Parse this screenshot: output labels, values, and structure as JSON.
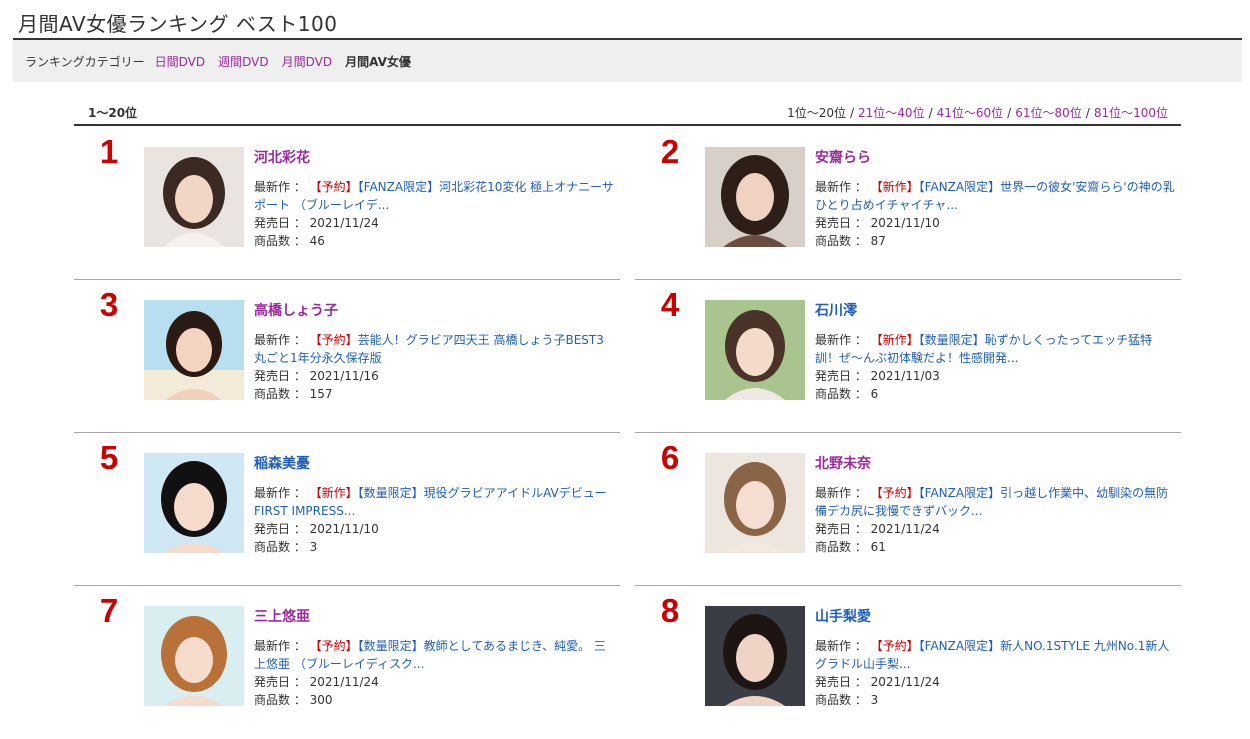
{
  "page_title": "月間AV女優ランキング ベスト100",
  "category_bar": {
    "label": "ランキングカテゴリー",
    "links": [
      "日間DVD",
      "週間DVD",
      "月間DVD"
    ],
    "current": "月間AV女優"
  },
  "range_label": "1～20位",
  "pager": {
    "current": "1位～20位",
    "links": [
      "21位～40位",
      "41位～60位",
      "61位～80位",
      "81位～100位"
    ],
    "separator": "/"
  },
  "labels": {
    "latest": "最新作 ：",
    "release_date": "発売日 ：",
    "item_count": "商品数 ："
  },
  "colors": {
    "rank": "#cc0000",
    "link_purple": "#9b2a9e",
    "link_blue": "#1f5fb8"
  },
  "ranking": [
    {
      "rank": "1",
      "name": "河北彩花",
      "name_color": "purple",
      "tag": "【予約】",
      "work": "【FANZA限定】河北彩花10変化 極上オナニーサポート （ブルーレイデ...",
      "release_date": "2021/11/24",
      "item_count": "46"
    },
    {
      "rank": "2",
      "name": "安齋らら",
      "name_color": "purple",
      "tag": "【新作】",
      "work": "【FANZA限定】世界一の彼女'安齋らら'の神の乳ひとり占めイチャイチャ...",
      "release_date": "2021/11/10",
      "item_count": "87"
    },
    {
      "rank": "3",
      "name": "高橋しょう子",
      "name_color": "purple",
      "tag": "【予約】",
      "work": "芸能人！グラビア四天王 高橋しょう子BEST3丸ごと1年分永久保存版",
      "release_date": "2021/11/16",
      "item_count": "157"
    },
    {
      "rank": "4",
      "name": "石川澪",
      "name_color": "blue",
      "tag": "【新作】",
      "work": "【数量限定】恥ずかしくったってエッチ猛特訓！ぜ～んぶ初体験だよ！性感開発...",
      "release_date": "2021/11/03",
      "item_count": "6"
    },
    {
      "rank": "5",
      "name": "稲森美憂",
      "name_color": "blue",
      "tag": "【新作】",
      "work": "【数量限定】現役グラビアアイドルAVデビュー FIRST IMPRESS...",
      "release_date": "2021/11/10",
      "item_count": "3"
    },
    {
      "rank": "6",
      "name": "北野未奈",
      "name_color": "purple",
      "tag": "【予約】",
      "work": "【FANZA限定】引っ越し作業中、幼馴染の無防備デカ尻に我慢できずバック...",
      "release_date": "2021/11/24",
      "item_count": "61"
    },
    {
      "rank": "7",
      "name": "三上悠亜",
      "name_color": "purple",
      "tag": "【予約】",
      "work": "【数量限定】教師としてあるまじき、純愛。 三上悠亜 （ブルーレイディスク...",
      "release_date": "2021/11/24",
      "item_count": "300"
    },
    {
      "rank": "8",
      "name": "山手梨愛",
      "name_color": "blue",
      "tag": "【予約】",
      "work": "【FANZA限定】新人NO.1STYLE 九州No.1新人グラドル山手梨...",
      "release_date": "2021/11/24",
      "item_count": "3"
    }
  ]
}
